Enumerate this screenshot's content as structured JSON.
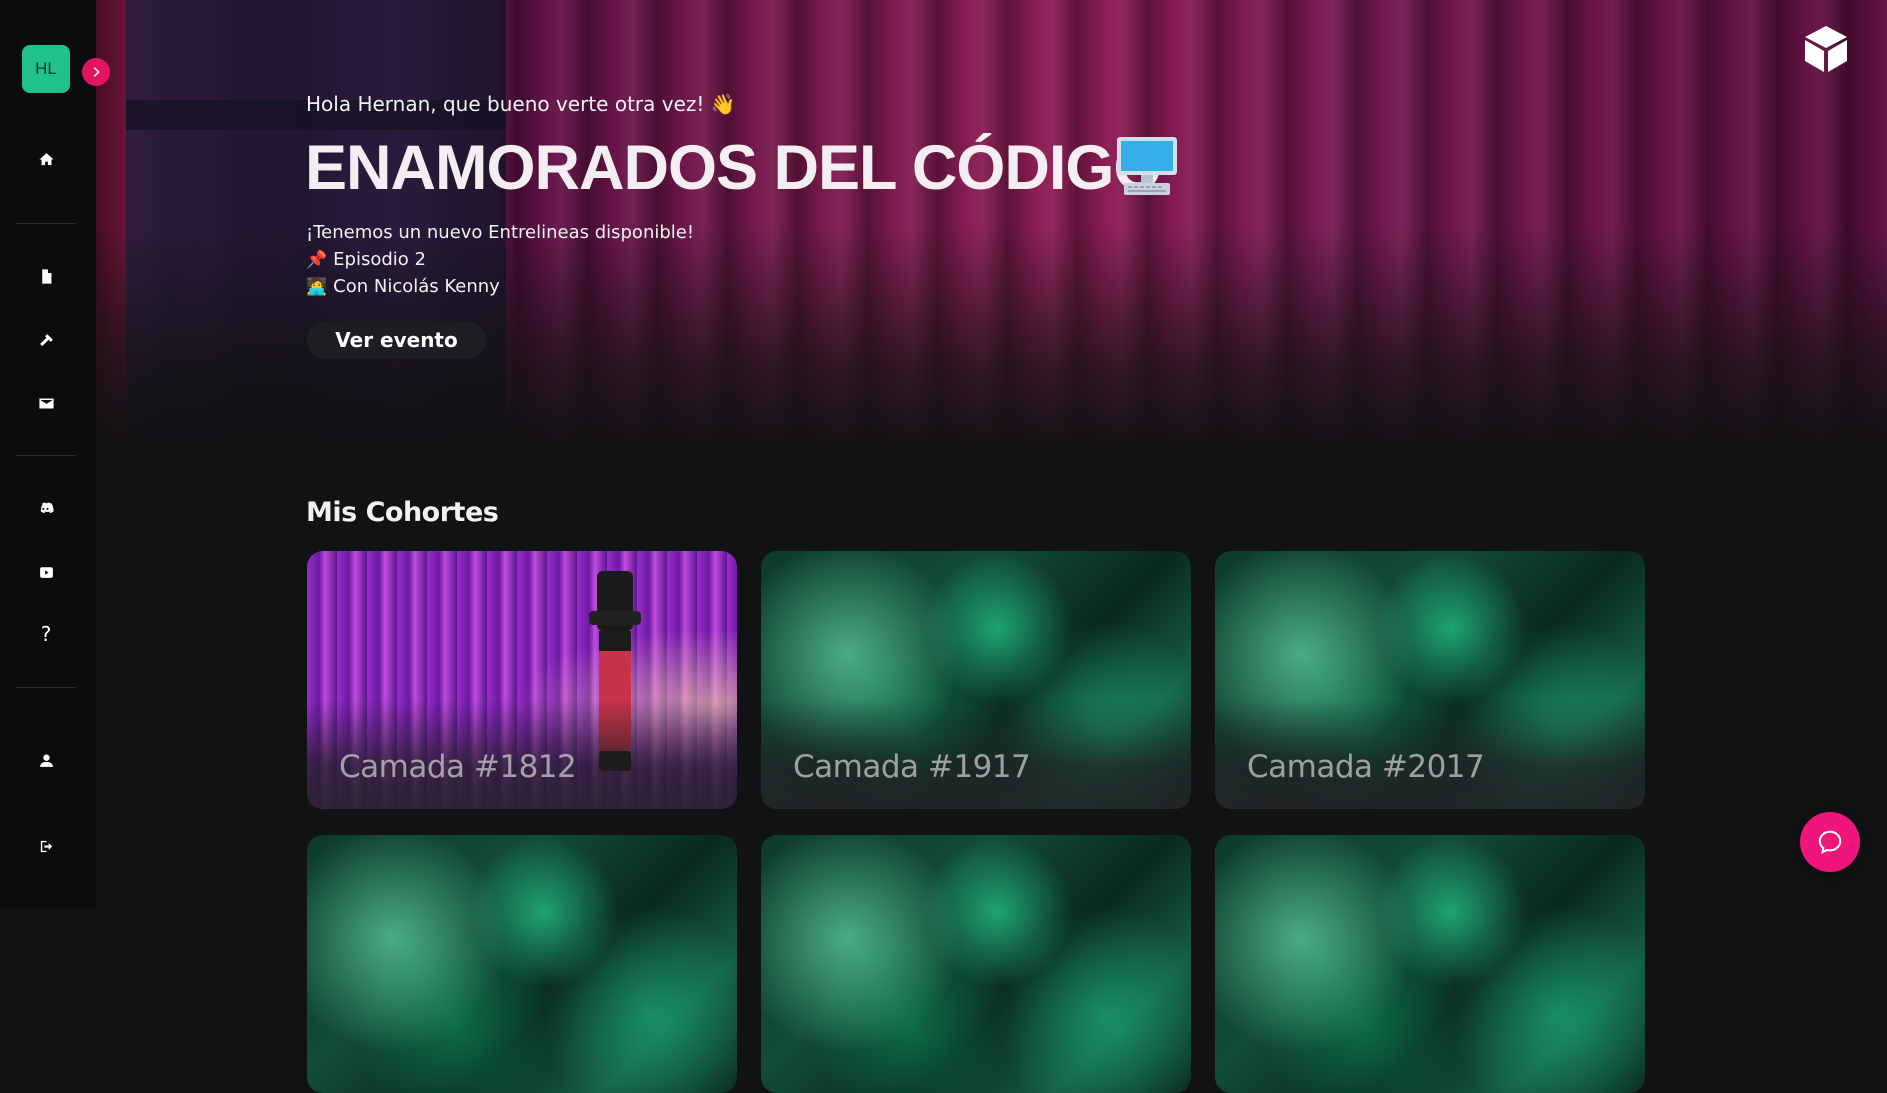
{
  "sidebar": {
    "avatar_initials": "HL",
    "items": [
      {
        "name": "home",
        "icon": "home-icon"
      },
      {
        "name": "documents",
        "icon": "document-icon"
      },
      {
        "name": "tools",
        "icon": "hammer-icon"
      },
      {
        "name": "messages",
        "icon": "envelope-icon"
      },
      {
        "name": "discord",
        "icon": "discord-icon"
      },
      {
        "name": "youtube",
        "icon": "youtube-icon"
      },
      {
        "name": "help",
        "icon": "question-icon",
        "glyph": "?"
      },
      {
        "name": "profile",
        "icon": "user-icon"
      },
      {
        "name": "logout",
        "icon": "logout-icon"
      }
    ]
  },
  "hero": {
    "greeting": "Hola Hernan, que bueno verte otra vez! 👋",
    "title": "ENAMORADOS DEL CÓDIGO",
    "announcement": "¡Tenemos un nuevo Entrelineas disponible!",
    "episode": "Episodio 2",
    "guest": "Con Nicolás Kenny",
    "cta_label": "Ver evento"
  },
  "cohorts": {
    "title": "Mis Cohortes",
    "cards": [
      {
        "label": "Camada #1812",
        "theme": "microphone"
      },
      {
        "label": "Camada #1917",
        "theme": "green-crystals"
      },
      {
        "label": "Camada #2017",
        "theme": "green-crystals"
      }
    ]
  },
  "colors": {
    "accent": "#e2145f",
    "avatar_bg": "#1fc38a",
    "help_fab": "#f0157a",
    "sidebar_bg": "#0b0c0d",
    "page_bg": "#111213"
  }
}
